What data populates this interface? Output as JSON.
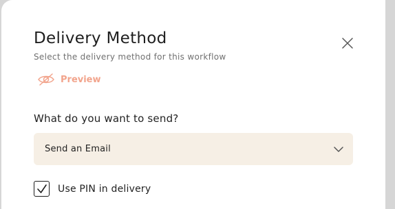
{
  "dialog": {
    "title": "Delivery Method",
    "subtitle": "Select the delivery method for this workflow",
    "preview_label": "Preview",
    "question": "What do you want to send?",
    "select": {
      "value": "Send an Email"
    },
    "pin_checkbox": {
      "label": "Use PIN in delivery",
      "checked": true
    }
  },
  "icons": {
    "close": "close-icon",
    "preview": "eye-off-icon",
    "dropdown": "chevron-down-icon",
    "check": "checkmark-icon"
  },
  "colors": {
    "accent": "#f2a48c",
    "select_bg": "#f6efe5",
    "text": "#1c1c1c"
  }
}
